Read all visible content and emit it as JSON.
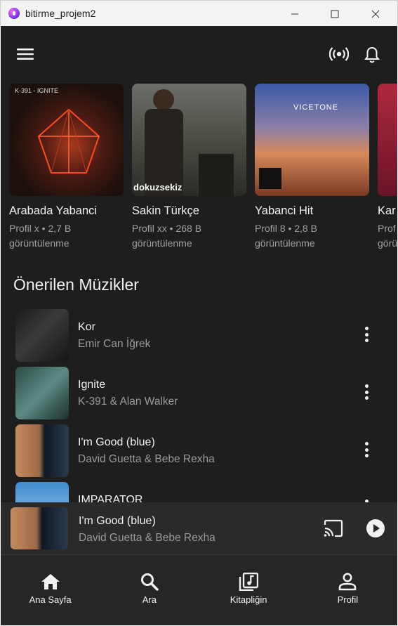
{
  "window": {
    "title": "bitirme_projem2"
  },
  "header": {
    "menu_icon": "menu-icon",
    "live_icon": "broadcast-icon",
    "notification_icon": "bell-icon"
  },
  "cards": [
    {
      "title": "Arabada Yabanci",
      "sub1": "Profil x • 2,7 B",
      "sub2": "görüntülenme",
      "cover_text": "K-391 - IGNITE"
    },
    {
      "title": "Sakin Türkçe",
      "sub1": "Profil xx • 268 B",
      "sub2": "görüntülenme",
      "cover_text": "dokuzsekiz"
    },
    {
      "title": "Yabanci Hit",
      "sub1": "Profil 8 • 2,8 B",
      "sub2": "görüntülenme",
      "cover_text": "VICETONE"
    },
    {
      "title": "Kar",
      "sub1": "Prof",
      "sub2": "görü",
      "cover_text": ""
    }
  ],
  "section": {
    "title": "Önerilen Müzikler"
  },
  "songs": [
    {
      "title": "Kor",
      "artist": "Emir Can İğrek"
    },
    {
      "title": "Ignite",
      "artist": "K-391 & Alan Walker"
    },
    {
      "title": "I'm Good (blue)",
      "artist": "David Guetta & Bebe Rexha"
    },
    {
      "title": "IMPARATOR",
      "artist": ""
    }
  ],
  "player": {
    "title": "I'm Good (blue)",
    "artist": "David Guetta & Bebe Rexha"
  },
  "nav": [
    {
      "label": "Ana Sayfa",
      "icon": "home-icon"
    },
    {
      "label": "Ara",
      "icon": "search-icon"
    },
    {
      "label": "Kitapliğin",
      "icon": "library-icon"
    },
    {
      "label": "Profil",
      "icon": "person-icon"
    }
  ],
  "colors": {
    "background": "#1e1e1e",
    "player": "#2a2a2a",
    "nav": "#262626",
    "text": "#f2f2f2",
    "muted": "#9a9a9a"
  }
}
